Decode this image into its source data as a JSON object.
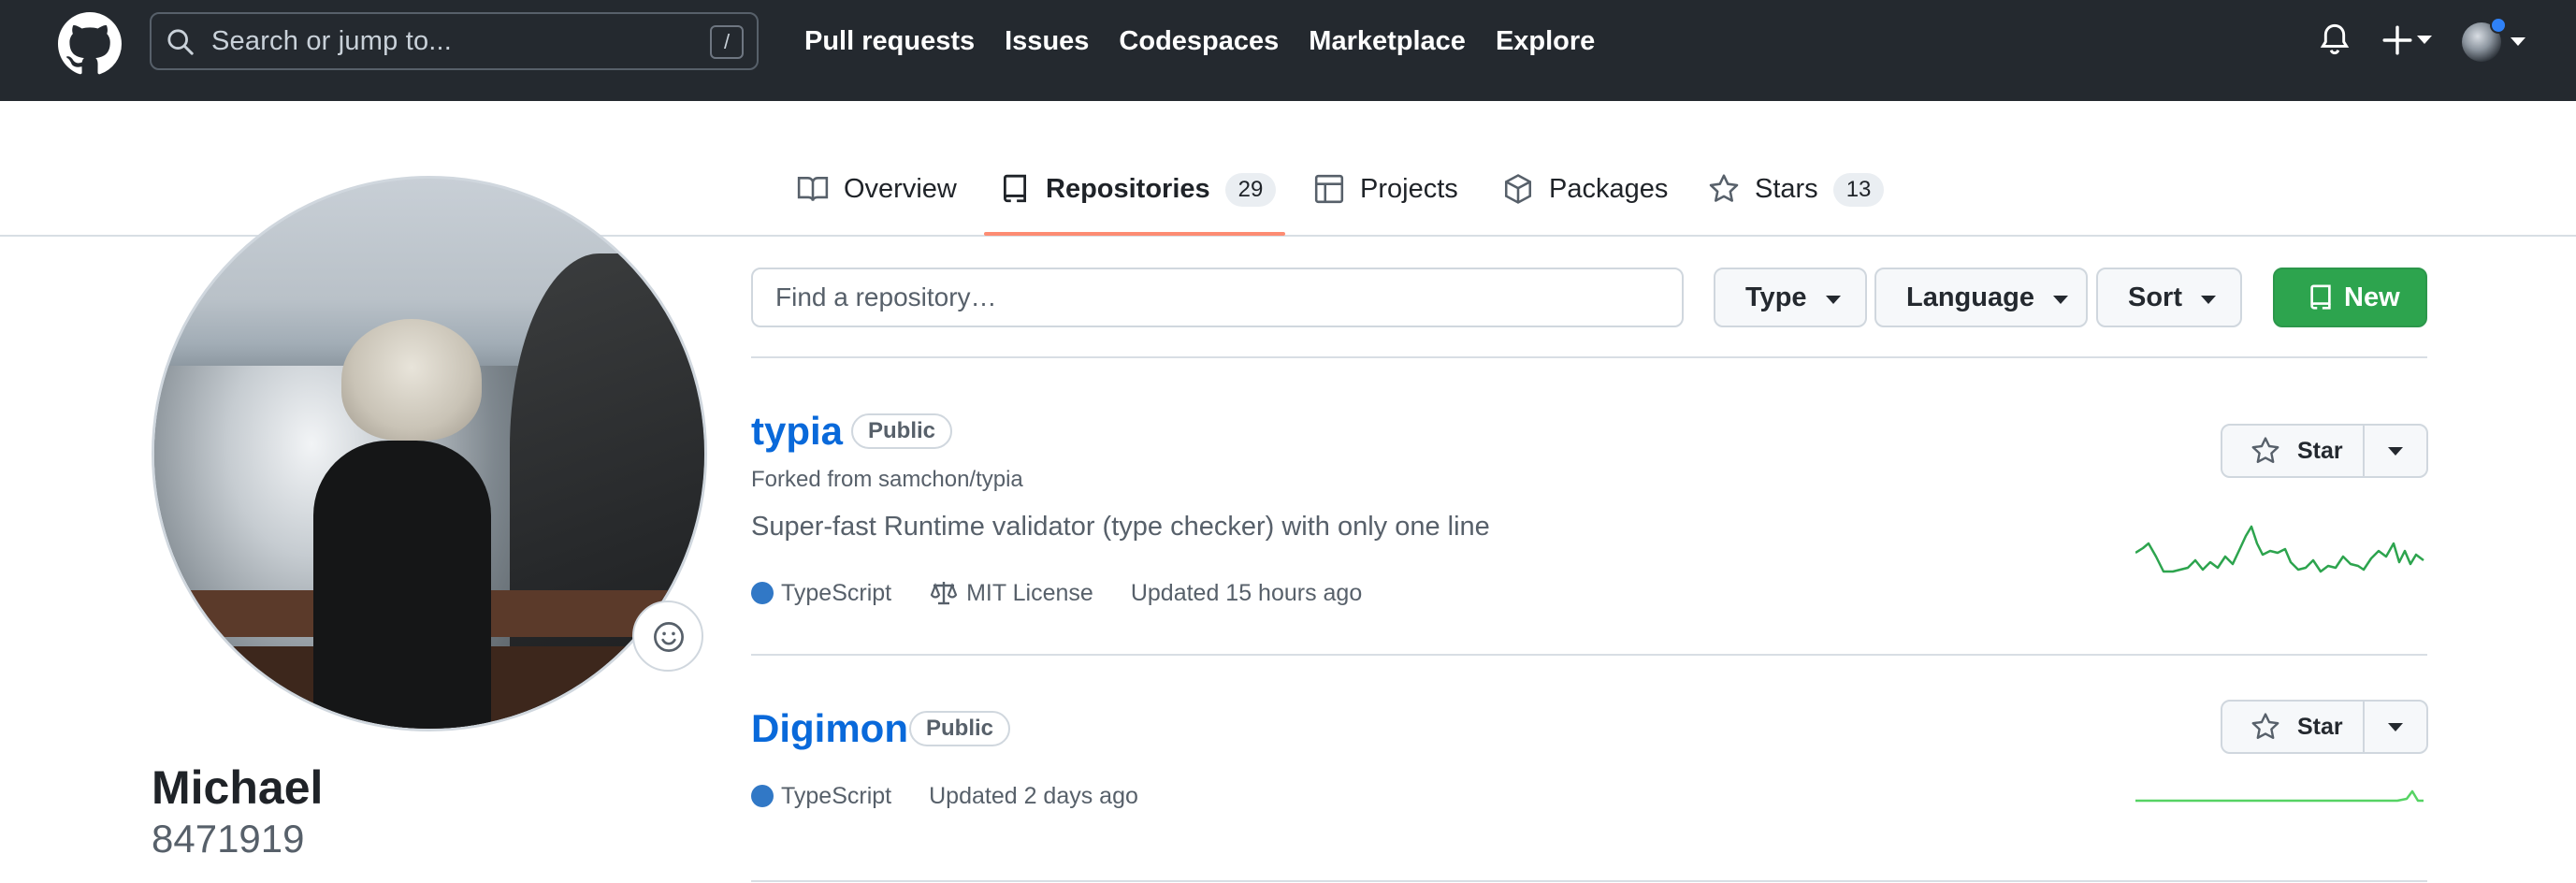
{
  "header": {
    "search_placeholder": "Search or jump to...",
    "search_shortcut": "/",
    "nav": [
      {
        "label": "Pull requests"
      },
      {
        "label": "Issues"
      },
      {
        "label": "Codespaces"
      },
      {
        "label": "Marketplace"
      },
      {
        "label": "Explore"
      }
    ],
    "icons": [
      "github-logo-icon",
      "search-icon",
      "bell-icon",
      "plus-icon",
      "avatar"
    ]
  },
  "tabs": [
    {
      "label": "Overview",
      "icon": "book-icon"
    },
    {
      "label": "Repositories",
      "icon": "repo-icon",
      "count": "29",
      "active": true
    },
    {
      "label": "Projects",
      "icon": "table-icon"
    },
    {
      "label": "Packages",
      "icon": "package-icon"
    },
    {
      "label": "Stars",
      "icon": "star-icon",
      "count": "13"
    }
  ],
  "profile": {
    "name": "Michael",
    "login": "8471919"
  },
  "filters": {
    "find_placeholder": "Find a repository…",
    "type_label": "Type",
    "language_label": "Language",
    "sort_label": "Sort",
    "new_label": "New"
  },
  "repos": [
    {
      "name": "typia",
      "visibility": "Public",
      "forked_from": "Forked from samchon/typia",
      "description": "Super-fast Runtime validator (type checker) with only one line",
      "language": "TypeScript",
      "language_color": "#3178c6",
      "license": "MIT License",
      "updated": "Updated 15 hours ago",
      "star_label": "Star"
    },
    {
      "name": "Digimon",
      "visibility": "Public",
      "language": "TypeScript",
      "language_color": "#3178c6",
      "updated": "Updated 2 days ago",
      "star_label": "Star"
    }
  ],
  "colors": {
    "header_bg": "#24292f",
    "accent_link": "#0969da",
    "tab_underline": "#fd8c73",
    "new_button": "#2da44e",
    "sparkline": "#2da44e"
  }
}
